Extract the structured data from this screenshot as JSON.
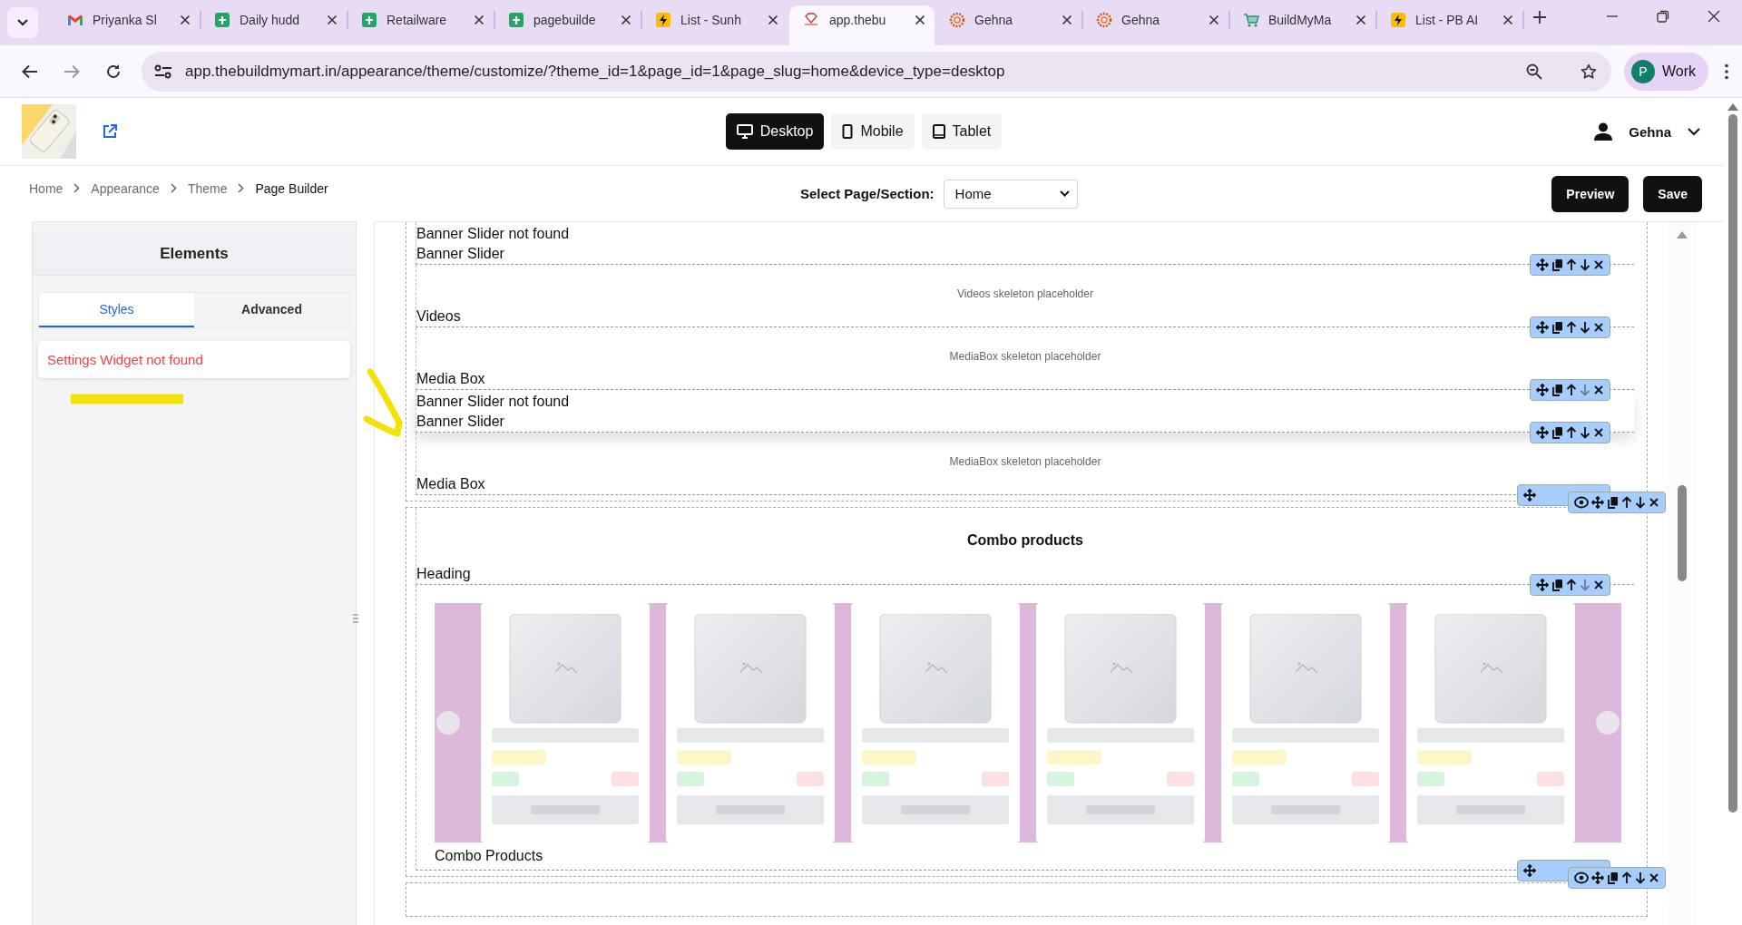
{
  "browser": {
    "tabs": [
      {
        "title": "Priyanka Sl",
        "selected": false
      },
      {
        "title": "Daily hudd",
        "selected": false
      },
      {
        "title": "Retailware",
        "selected": false
      },
      {
        "title": "pagebuilde",
        "selected": false
      },
      {
        "title": "List - Sunh",
        "selected": false
      },
      {
        "title": "app.thebu",
        "selected": true
      },
      {
        "title": "Gehna",
        "selected": false
      },
      {
        "title": "Gehna",
        "selected": false
      },
      {
        "title": "BuildMyMa",
        "selected": false
      },
      {
        "title": "List - PB AI",
        "selected": false
      }
    ],
    "url": "app.thebuildmymart.in/appearance/theme/customize/?theme_id=1&page_id=1&page_slug=home&device_type=desktop",
    "profile": {
      "initial": "P",
      "label": "Work"
    }
  },
  "header": {
    "devices": [
      {
        "label": "Desktop",
        "selected": true
      },
      {
        "label": "Mobile",
        "selected": false
      },
      {
        "label": "Tablet",
        "selected": false
      }
    ],
    "user": "Gehna"
  },
  "breadcrumb": [
    "Home",
    "Appearance",
    "Theme",
    "Page Builder"
  ],
  "page_select": {
    "label": "Select Page/Section:",
    "value": "Home"
  },
  "actions": [
    "Preview",
    "Save"
  ],
  "elements_panel": {
    "title": "Elements",
    "tabs": [
      {
        "label": "Styles",
        "selected": true
      },
      {
        "label": "Advanced",
        "selected": false
      }
    ],
    "message": "Settings Widget not found"
  },
  "canvas": {
    "sections": [
      {
        "blocks": [
          {
            "kind": "widget",
            "lines": [
              "Banner Slider not found"
            ],
            "label": "Banner Slider",
            "selected": false,
            "toolbar": {
              "down_disabled": false
            }
          },
          {
            "kind": "widget",
            "placeholder": "Videos skeleton placeholder",
            "label": "Videos",
            "selected": false,
            "toolbar": {
              "down_disabled": false
            }
          },
          {
            "kind": "widget",
            "placeholder": "MediaBox skeleton placeholder",
            "label": "Media Box",
            "selected": false,
            "toolbar": {
              "down_disabled": true
            }
          },
          {
            "kind": "widget",
            "lines": [
              "Banner Slider not found"
            ],
            "label": "Banner Slider",
            "selected": true,
            "toolbar": {
              "down_disabled": false
            }
          },
          {
            "kind": "widget",
            "placeholder": "MediaBox skeleton placeholder",
            "label": "Media Box",
            "selected": false
          }
        ]
      },
      {
        "blocks": [
          {
            "kind": "heading",
            "heading": "Combo products",
            "label": "Heading",
            "selected": false,
            "toolbar": {
              "down_disabled": true
            }
          },
          {
            "kind": "carousel",
            "cards": [
              {
                "kind": "skeleton"
              },
              {
                "kind": "skeleton"
              },
              {
                "kind": "skeleton"
              },
              {
                "kind": "skeleton"
              },
              {
                "kind": "skeleton"
              },
              {
                "kind": "skeleton"
              }
            ],
            "label": "Combo Products",
            "selected": false
          }
        ]
      }
    ]
  }
}
